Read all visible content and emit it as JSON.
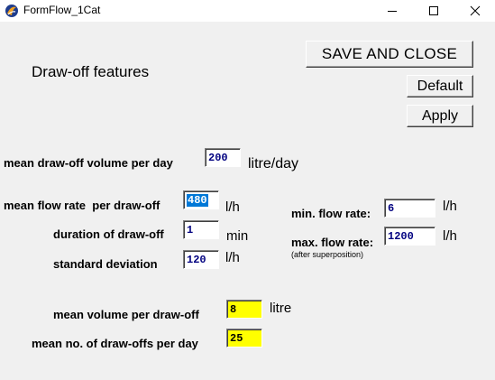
{
  "window": {
    "title": "FormFlow_1Cat",
    "icon": "formflow-app-icon"
  },
  "heading": "Draw-off features",
  "buttons": {
    "save_close": "SAVE AND CLOSE",
    "default": "Default",
    "apply": "Apply"
  },
  "fields": {
    "mean_volume_per_day": {
      "label": "mean draw-off volume per day",
      "value": "200",
      "unit": "litre/day"
    },
    "mean_flow_rate": {
      "label": "mean flow rate  per draw-off",
      "value": "480",
      "unit": "l/h"
    },
    "duration": {
      "label": "duration of draw-off",
      "value": "1",
      "unit": "min"
    },
    "std_deviation": {
      "label": "standard deviation",
      "value": "120",
      "unit": "l/h"
    },
    "min_flow_rate": {
      "label": "min. flow rate:",
      "value": "6",
      "unit": "l/h"
    },
    "max_flow_rate": {
      "label": "max. flow rate:",
      "value": "1200",
      "unit": "l/h",
      "note": "(after superposition)"
    },
    "mean_volume_per_drawoff": {
      "label": "mean volume per draw-off",
      "value": "8",
      "unit": "litre"
    },
    "drawoffs_per_day": {
      "label": "mean no. of draw-offs per day",
      "value": "25"
    }
  },
  "colors": {
    "computed_field_bg": "#ffff00",
    "input_text": "#000080",
    "selection": "#0078d7"
  }
}
